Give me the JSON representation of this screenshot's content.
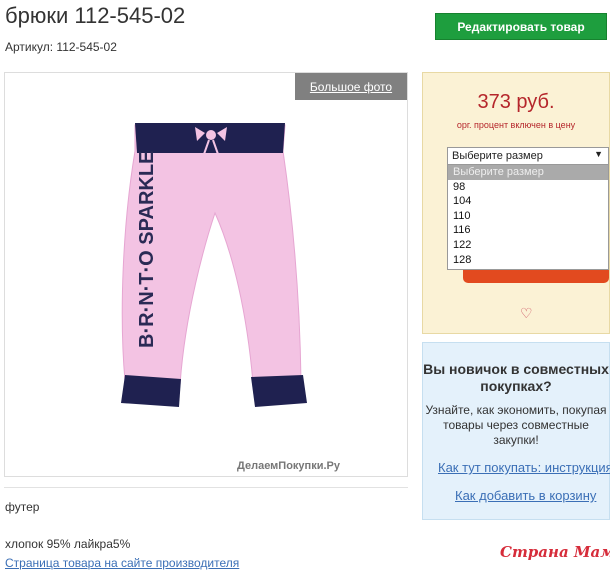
{
  "product": {
    "title": "брюки 112-545-02",
    "sku": "Артикул: 112-545-02",
    "edit_label": "Редактировать товар",
    "big_photo_label": "Большое фото",
    "image_text": "B·R·N·T·O SPARKLE",
    "watermark": "ДелаемПокупки.Ру",
    "description": "футер",
    "composition": "хлопок 95% лайкра5%",
    "maker_link": "Страница товара на сайте производителя"
  },
  "price_panel": {
    "price": "373 руб.",
    "note": "орг. процент включен в цену",
    "size_placeholder": "Выберите размер",
    "size_options": [
      "Выберите размер",
      "98",
      "104",
      "110",
      "116",
      "122",
      "128"
    ],
    "heart_icon": "heart-icon"
  },
  "info_panel": {
    "question": "Вы новичок в совместных покупках?",
    "text": "Узнайте, как экономить, покупая товары через совместные закупки!",
    "howto_link": "Как тут покупать: инструкция",
    "cart_link": "Как добавить в корзину"
  },
  "watermark_logo": "Страна Мам",
  "colors": {
    "edit_button": "#1e9e3e",
    "price": "#b5262b",
    "price_panel_bg": "#fbf2d5",
    "info_panel_bg": "#e4f1fb",
    "link": "#3b6fb6",
    "order_button": "#e24a1f"
  }
}
